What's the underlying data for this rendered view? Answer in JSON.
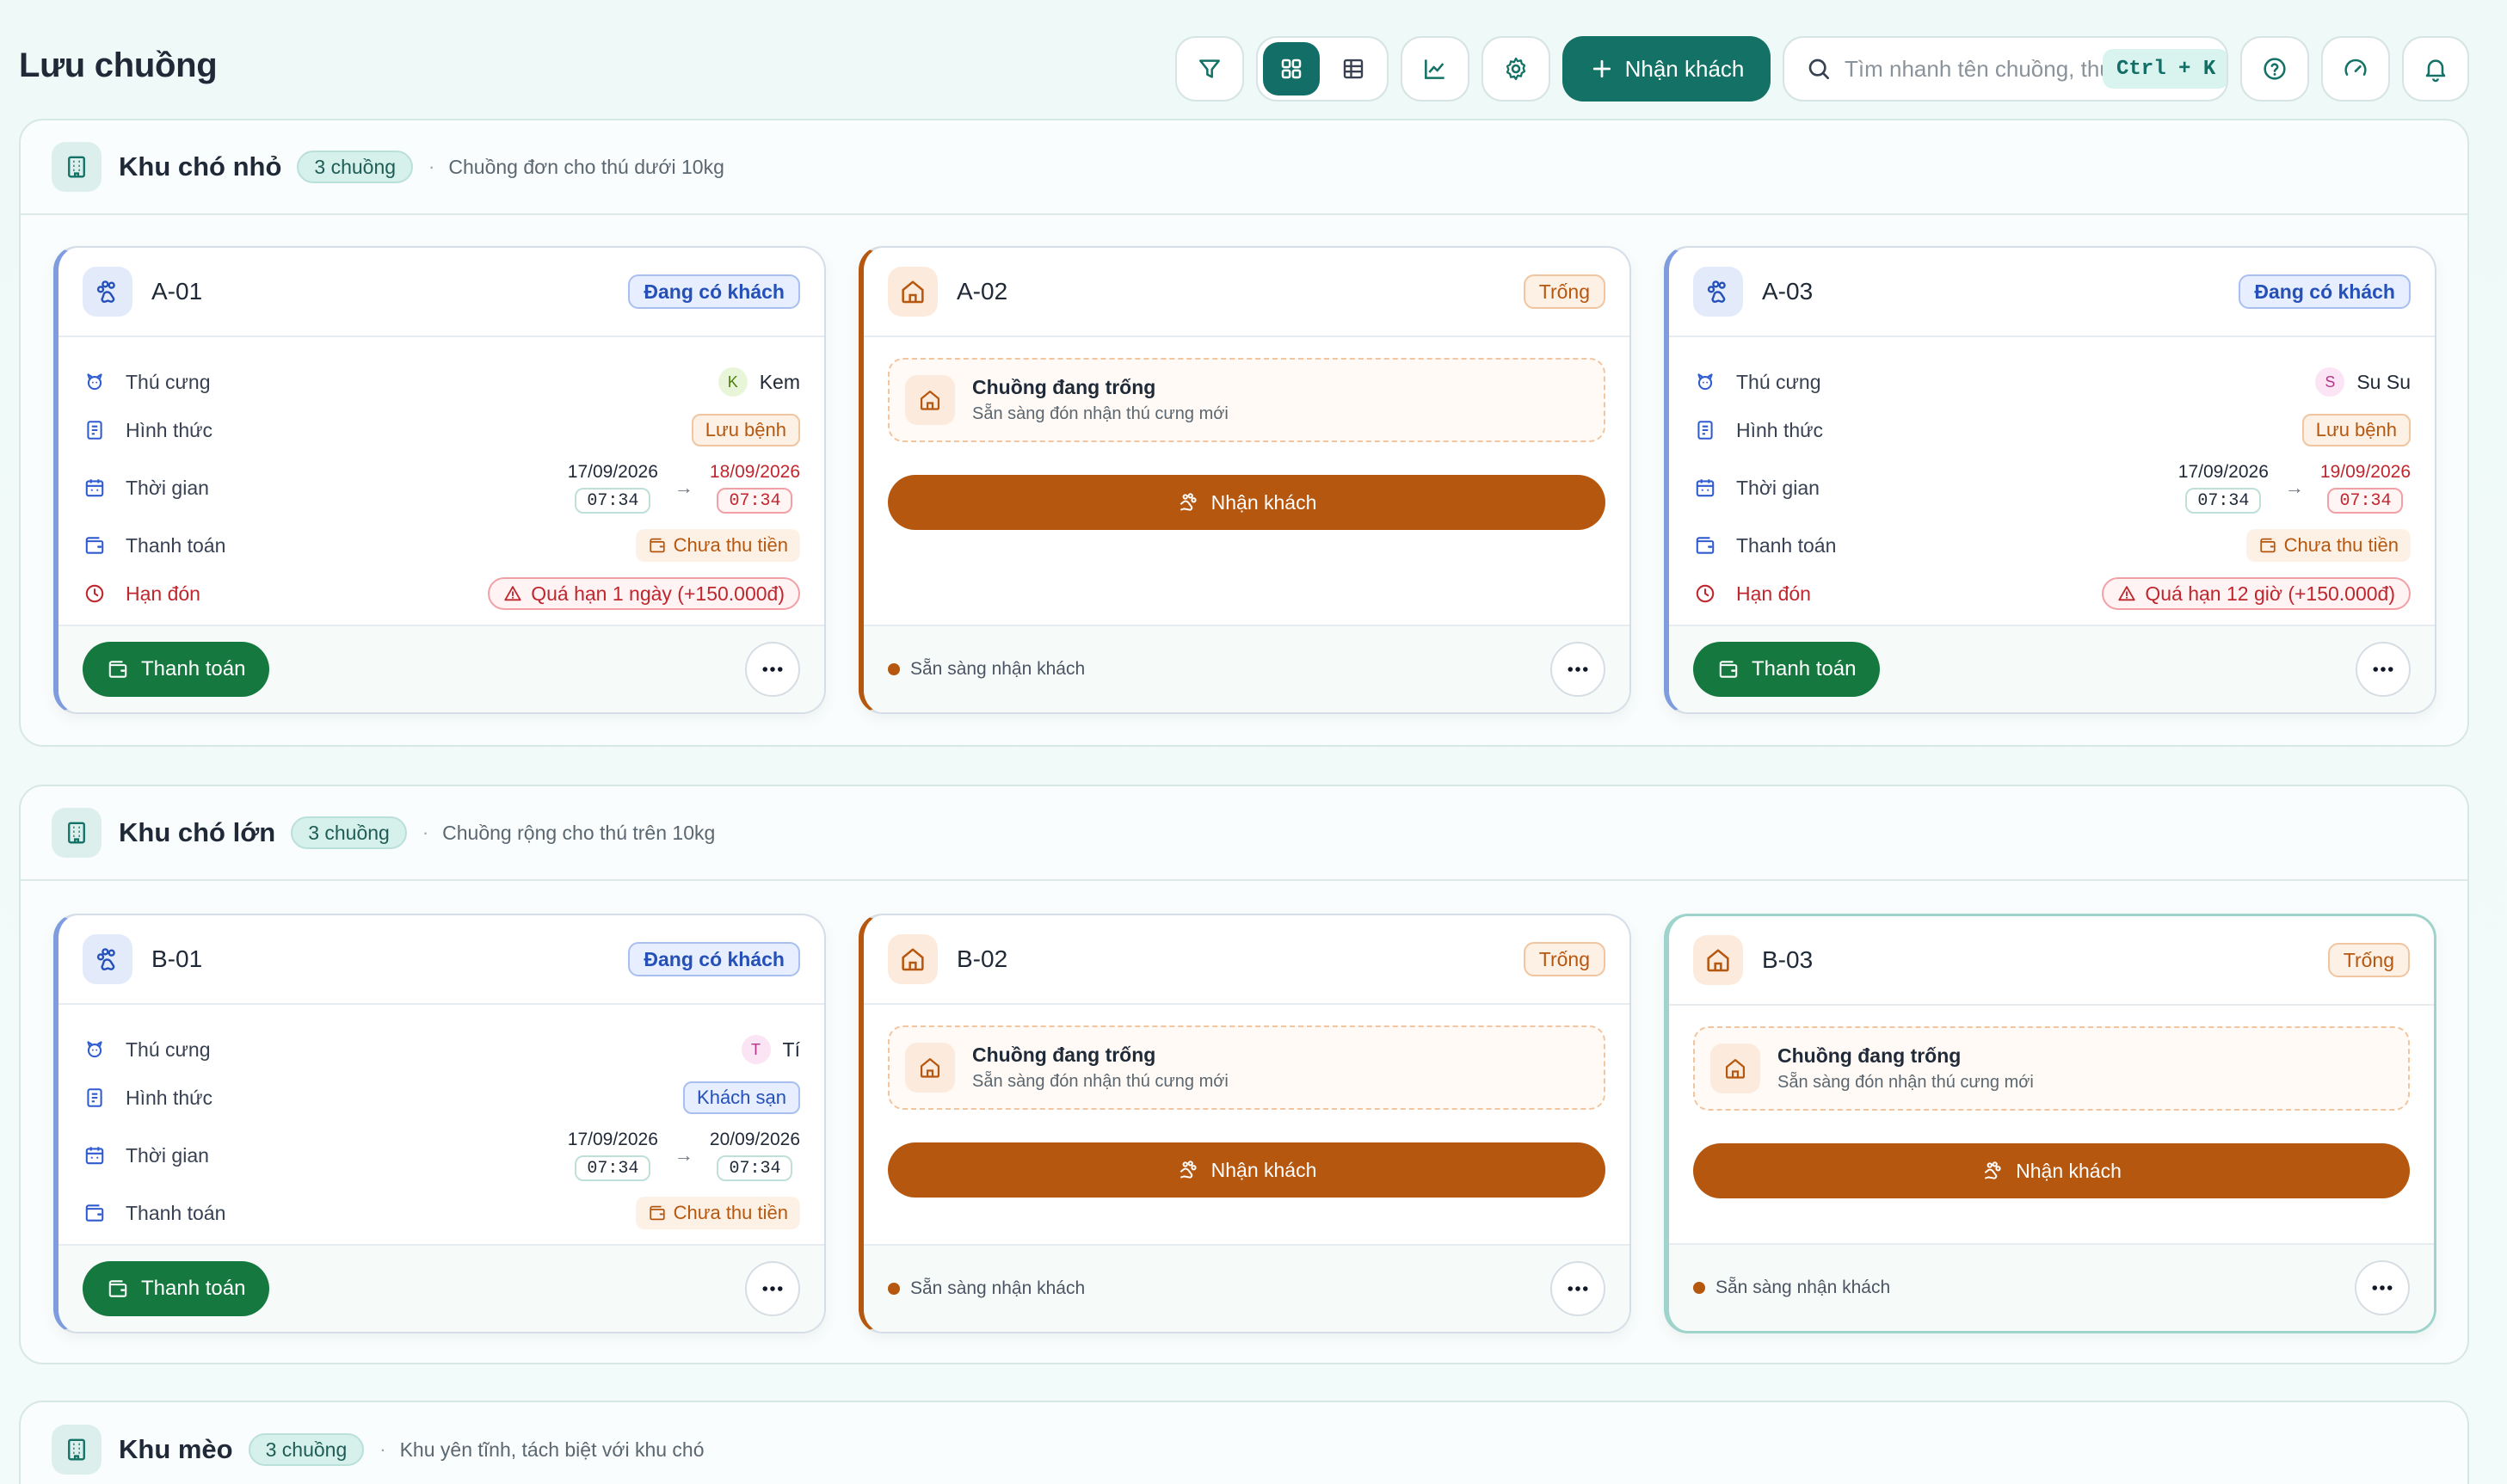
{
  "page": {
    "title": "Lưu chuồng"
  },
  "toolbar": {
    "filter_icon": "filter-icon",
    "view_grid_icon": "grid-icon",
    "view_table_icon": "table-icon",
    "chart_icon": "chart-icon",
    "settings_icon": "gear-icon",
    "receive_label": "Nhận khách",
    "search_placeholder": "Tìm nhanh tên chuồng, thú cưng...",
    "shortcut": "Ctrl + K",
    "help_icon": "help-icon",
    "speed_icon": "gauge-icon",
    "bell_icon": "bell-icon"
  },
  "labels": {
    "pet": "Thú cưng",
    "mode": "Hình thức",
    "time": "Thời gian",
    "payment": "Thanh toán",
    "deadline": "Hạn đón",
    "pay_button": "Thanh toán",
    "receive_button": "Nhận khách",
    "empty_title": "Chuồng đang trống",
    "empty_sub": "Sẵn sàng đón nhận thú cưng mới",
    "ready": "Sẵn sàng nhận khách",
    "unpaid": "Chưa thu tiền"
  },
  "colors": {
    "brand": "#137265",
    "occupied": "#2450b8",
    "empty": "#b6570f",
    "pay": "#15793f",
    "danger": "#c0262d"
  },
  "zones": [
    {
      "name": "Khu chó nhỏ",
      "count": "3 chuồng",
      "desc": "Chuồng đơn cho thú dưới 10kg",
      "cages": [
        {
          "id": "A-01",
          "status": "Đang có khách",
          "pet_initial": "K",
          "pet": "Kem",
          "mode": "Lưu bệnh",
          "from_date": "17/09/2026",
          "from_time": "07:34",
          "to_date": "18/09/2026",
          "to_time": "07:34",
          "payment": "Chưa thu tiền",
          "deadline": "Quá hạn 1 ngày (+150.000đ)"
        },
        {
          "id": "A-02",
          "status": "Trống"
        },
        {
          "id": "A-03",
          "status": "Đang có khách",
          "pet_initial": "S",
          "pet": "Su Su",
          "mode": "Lưu bệnh",
          "from_date": "17/09/2026",
          "from_time": "07:34",
          "to_date": "19/09/2026",
          "to_time": "07:34",
          "payment": "Chưa thu tiền",
          "deadline": "Quá hạn 12 giờ (+150.000đ)"
        }
      ]
    },
    {
      "name": "Khu chó lớn",
      "count": "3 chuồng",
      "desc": "Chuồng rộng cho thú trên 10kg",
      "cages": [
        {
          "id": "B-01",
          "status": "Đang có khách",
          "pet_initial": "T",
          "pet": "Tí",
          "mode": "Khách sạn",
          "from_date": "17/09/2026",
          "from_time": "07:34",
          "to_date": "20/09/2026",
          "to_time": "07:34",
          "payment": "Chưa thu tiền"
        },
        {
          "id": "B-02",
          "status": "Trống"
        },
        {
          "id": "B-03",
          "status": "Trống"
        }
      ]
    },
    {
      "name": "Khu mèo",
      "count": "3 chuồng",
      "desc": "Khu yên tĩnh, tách biệt với khu chó"
    }
  ]
}
